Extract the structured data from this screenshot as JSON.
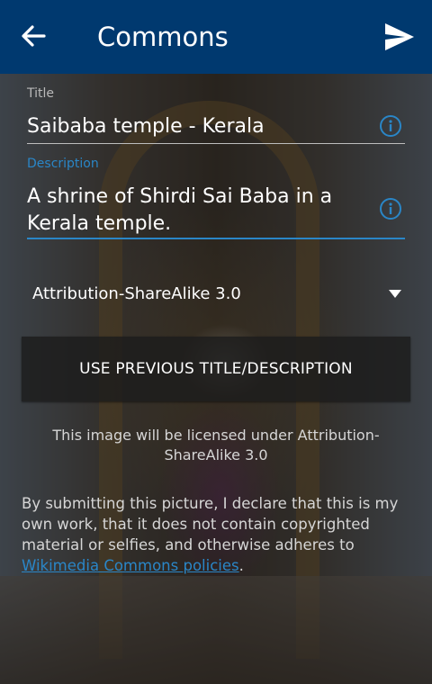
{
  "appbar": {
    "title": "Commons",
    "back_icon": "arrow-left-icon",
    "send_icon": "send-icon",
    "background_color": "#00396f"
  },
  "form": {
    "title_label": "Title",
    "title_value": "Saibaba temple - Kerala",
    "description_label": "Description",
    "description_value": "A shrine of Shirdi Sai Baba in a Kerala temple.",
    "info_icon": "info-icon",
    "accent_color": "#2a86c7"
  },
  "license": {
    "selected": "Attribution-ShareAlike 3.0"
  },
  "buttons": {
    "use_previous": "USE PREVIOUS TITLE/DESCRIPTION"
  },
  "notes": {
    "license_note": "This image will be licensed under Attribution-ShareAlike 3.0",
    "declaration_text": "By submitting this picture, I declare that this is my own work, that it does not contain copyrighted material or selfies, and otherwise adheres to ",
    "policy_link": "Wikimedia Commons policies",
    "declaration_end": "."
  }
}
